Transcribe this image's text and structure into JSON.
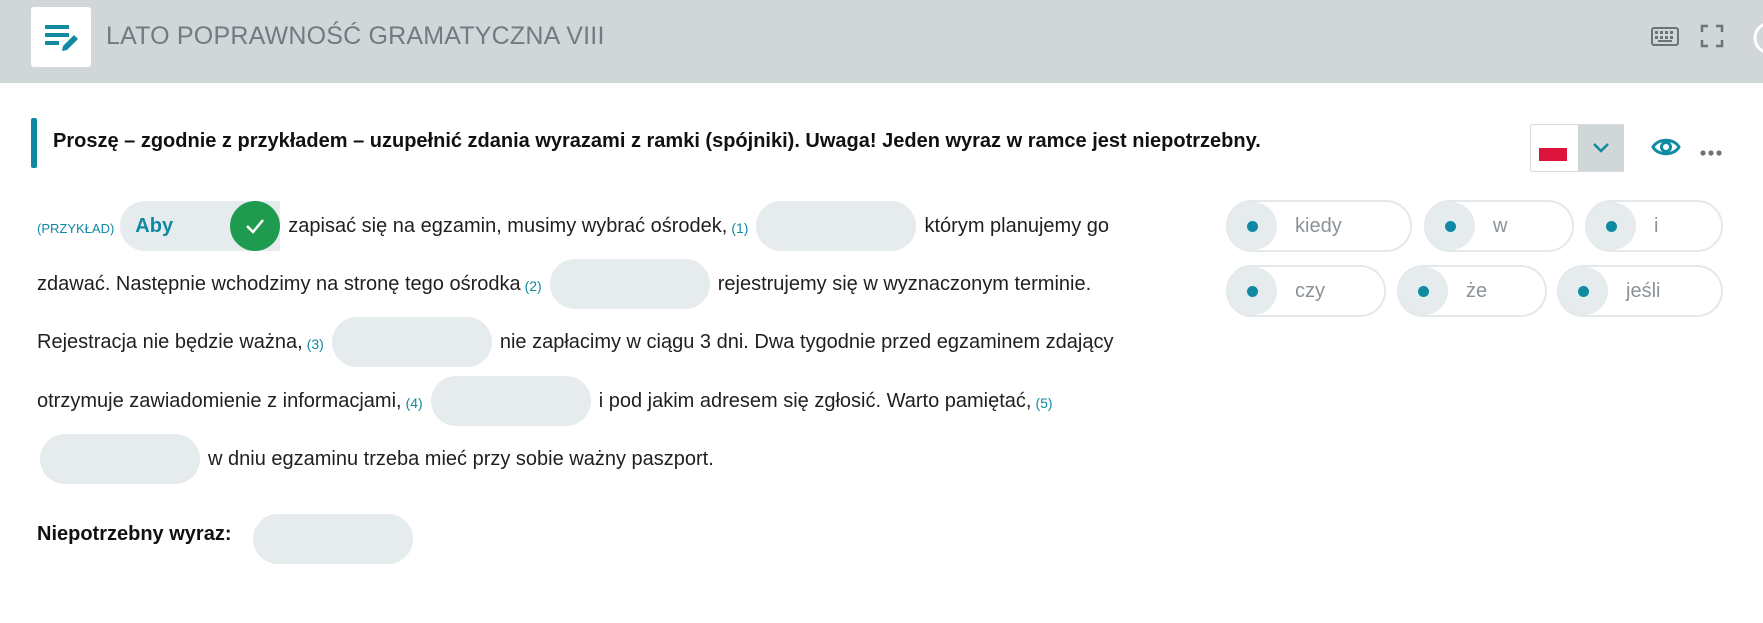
{
  "header": {
    "title": "LATO POPRAWNOŚĆ GRAMATYCZNA VIII"
  },
  "instruction": "Proszę – zgodnie z przykładem – uzupełnić zdania wyrazami z ramki (spójniki). Uwaga! Jeden wyraz w ramce jest niepotrzebny.",
  "exercise": {
    "example_label": "(PRZYKŁAD)",
    "example_answer": "Aby",
    "line1_a": "zapisać się na egzamin, musimy wybrać ośrodek,",
    "line1_b": "którym planujemy go",
    "line2_a": "zdawać. Następnie wchodzimy na stronę tego ośrodka",
    "line2_b": "rejestrujemy się w wyznaczonym terminie.",
    "line3_a": "Rejestracja nie będzie ważna,",
    "line3_b": "nie zapłacimy w ciągu 3 dni. Dwa tygodnie przed egzaminem zdający",
    "line4_a": "otrzymuje zawiadomienie z informacjami,",
    "line4_b": "i pod jakim adresem się zgłosić. Warto pamiętać,",
    "line5": "w dniu egzaminu trzeba mieć przy sobie ważny paszport.",
    "gap_numbers": [
      "(1)",
      "(2)",
      "(3)",
      "(4)",
      "(5)"
    ],
    "unneeded_label": "Niepotrzebny wyraz:"
  },
  "word_bank": [
    "kiedy",
    "w",
    "i",
    "czy",
    "że",
    "jeśli"
  ],
  "icons": {
    "app": "edit-list-icon",
    "keyboard": "keyboard-icon",
    "fullscreen": "fullscreen-icon",
    "language_flag": "polish-flag-icon",
    "language_dropdown": "chevron-down-icon",
    "preview": "eye-icon",
    "more": "more-icon",
    "example_correct": "check-icon",
    "chip_handle": "drag-dot-icon"
  },
  "colors": {
    "accent": "#0f8aa2",
    "topbar": "#d1d6d9",
    "gap_fill": "#e6ebee",
    "correct": "#1e9b4e",
    "flag_red": "#dc143c"
  }
}
